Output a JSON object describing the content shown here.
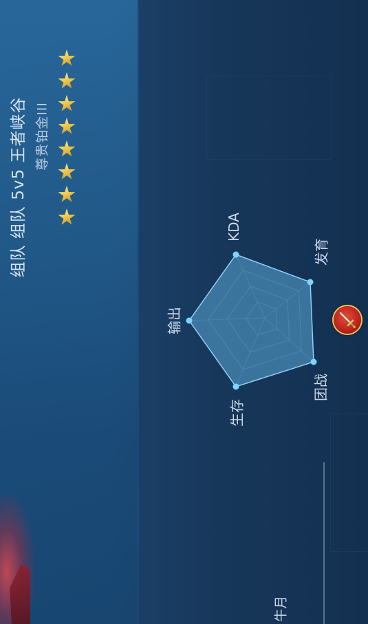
{
  "match": {
    "mode_title": "组队 组队 5v5 王者峡谷",
    "rank_name": "尊贵铂金III",
    "stars": 8
  },
  "radar": {
    "axes": [
      {
        "key": "kda",
        "label": "KDA"
      },
      {
        "key": "fayu",
        "label": "发育"
      },
      {
        "key": "tuanzhan",
        "label": "团战"
      },
      {
        "key": "shengcun",
        "label": "生存"
      },
      {
        "key": "shuchu",
        "label": "输出"
      }
    ]
  },
  "badge": {
    "icon": "sword-icon"
  },
  "partial_label": "牛月",
  "colors": {
    "background": "#1a3a5c",
    "radar_fill": "#5aa8d6",
    "radar_point": "#7fd4ff",
    "star_gold": "#f2c94c",
    "badge_red": "#c0281e"
  }
}
